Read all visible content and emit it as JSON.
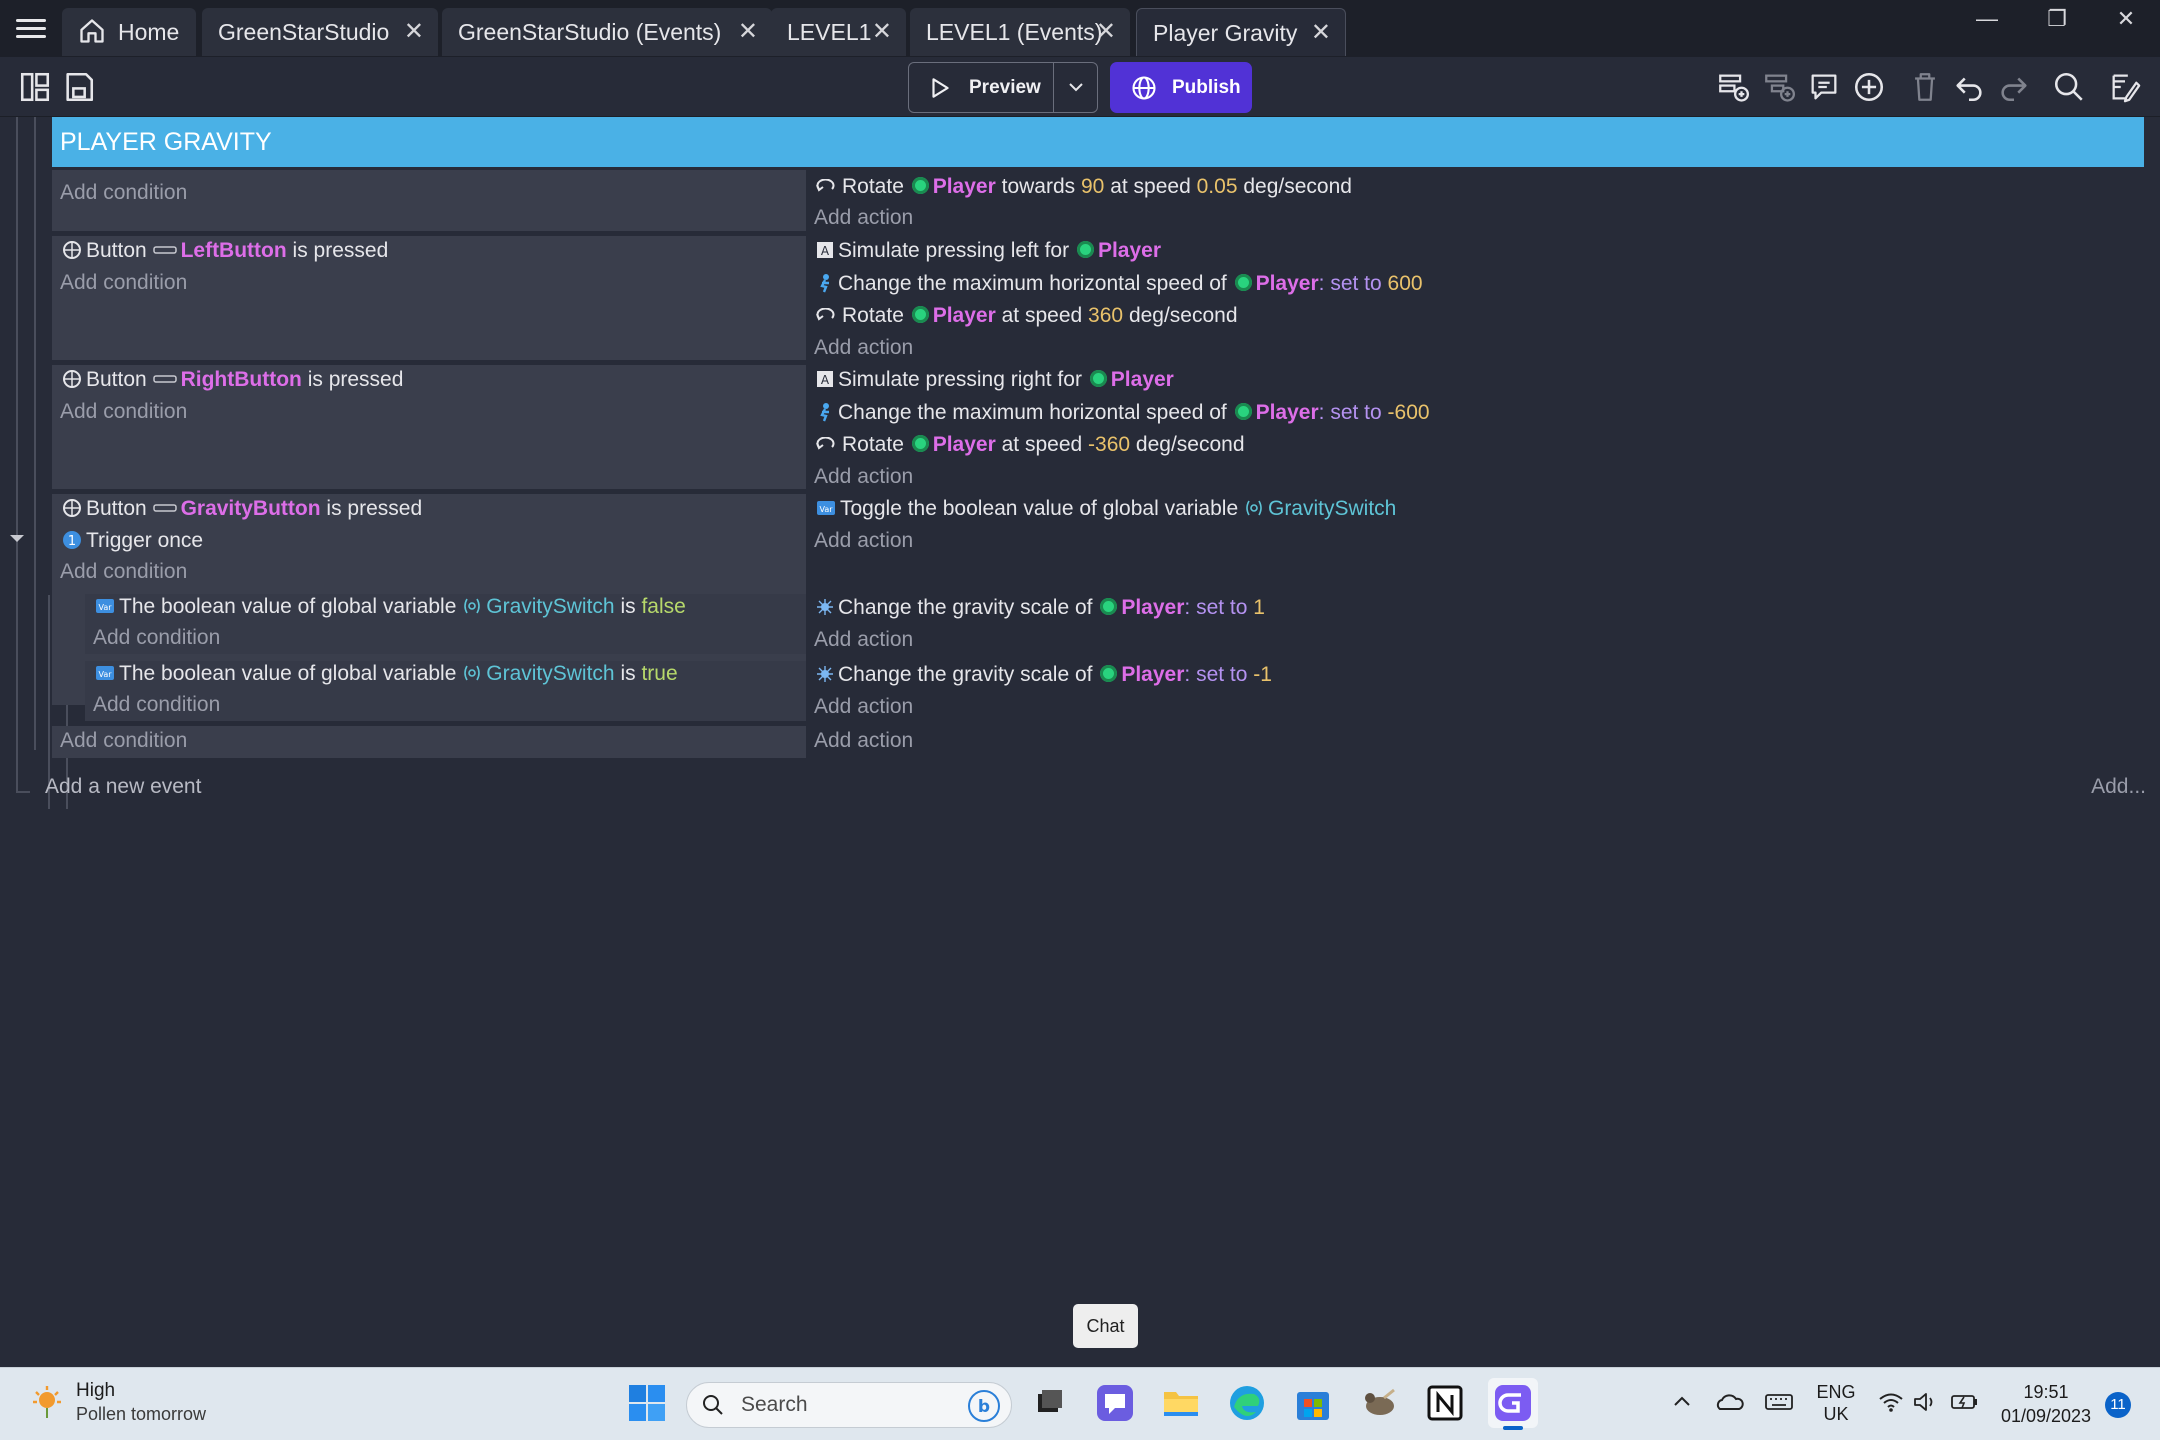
{
  "tabs": [
    {
      "label": "Home"
    },
    {
      "label": "GreenStarStudio"
    },
    {
      "label": "GreenStarStudio (Events)"
    },
    {
      "label": "LEVEL1"
    },
    {
      "label": "LEVEL1 (Events)"
    },
    {
      "label": "Player Gravity"
    }
  ],
  "toolbar": {
    "preview_label": "Preview",
    "publish_label": "Publish"
  },
  "group": {
    "title": "PLAYER GRAVITY"
  },
  "common": {
    "add_condition": "Add condition",
    "add_action": "Add action"
  },
  "events": {
    "e0": {
      "a0": {
        "t1": "Rotate",
        "obj": "Player",
        "t2": "towards",
        "v1": "90",
        "t3": "at speed",
        "v2": "0.05",
        "t4": "deg/second"
      }
    },
    "e1": {
      "c0": {
        "t1": "Button",
        "obj": "LeftButton",
        "t2": "is pressed"
      },
      "a0": {
        "t1": "Simulate pressing left for",
        "obj": "Player"
      },
      "a1": {
        "t1": "Change the maximum horizontal speed of",
        "obj": "Player",
        "sep": ":",
        "op": "set to",
        "val": "600"
      },
      "a2": {
        "t1": "Rotate",
        "obj": "Player",
        "t2": "at speed",
        "val": "360",
        "t3": "deg/second"
      }
    },
    "e2": {
      "c0": {
        "t1": "Button",
        "obj": "RightButton",
        "t2": "is pressed"
      },
      "a0": {
        "t1": "Simulate pressing right for",
        "obj": "Player"
      },
      "a1": {
        "t1": "Change the maximum horizontal speed of",
        "obj": "Player",
        "sep": ":",
        "op": "set to",
        "val": "-600"
      },
      "a2": {
        "t1": "Rotate",
        "obj": "Player",
        "t2": "at speed",
        "val": "-360",
        "t3": "deg/second"
      }
    },
    "e3": {
      "c0": {
        "t1": "Button",
        "obj": "GravityButton",
        "t2": "is pressed"
      },
      "c1": {
        "t1": "Trigger once"
      },
      "a0": {
        "t1": "Toggle the boolean value of global variable",
        "var": "GravitySwitch"
      }
    },
    "e3s0": {
      "c0": {
        "t1": "The boolean value of global variable",
        "var": "GravitySwitch",
        "t2": "is",
        "val": "false"
      },
      "a0": {
        "t1": "Change the gravity scale of",
        "obj": "Player",
        "sep": ":",
        "op": "set to",
        "val": "1"
      }
    },
    "e3s1": {
      "c0": {
        "t1": "The boolean value of global variable",
        "var": "GravitySwitch",
        "t2": "is",
        "val": "true"
      },
      "a0": {
        "t1": "Change the gravity scale of",
        "obj": "Player",
        "sep": ":",
        "op": "set to",
        "val": "-1"
      }
    }
  },
  "footer": {
    "add_event": "Add a new event",
    "add_more": "Add..."
  },
  "tooltip": {
    "chat": "Chat"
  },
  "taskbar": {
    "weather_title": "High",
    "weather_sub": "Pollen tomorrow",
    "search_placeholder": "Search",
    "lang_line1": "ENG",
    "lang_line2": "UK",
    "time": "19:51",
    "date": "01/09/2023",
    "notifications": "11"
  },
  "colors": {
    "group_header": "#4ab1e6",
    "publish": "#5132d6",
    "object": "#dd6ee8",
    "number": "#e9c26b",
    "variable": "#5ec4d6"
  }
}
